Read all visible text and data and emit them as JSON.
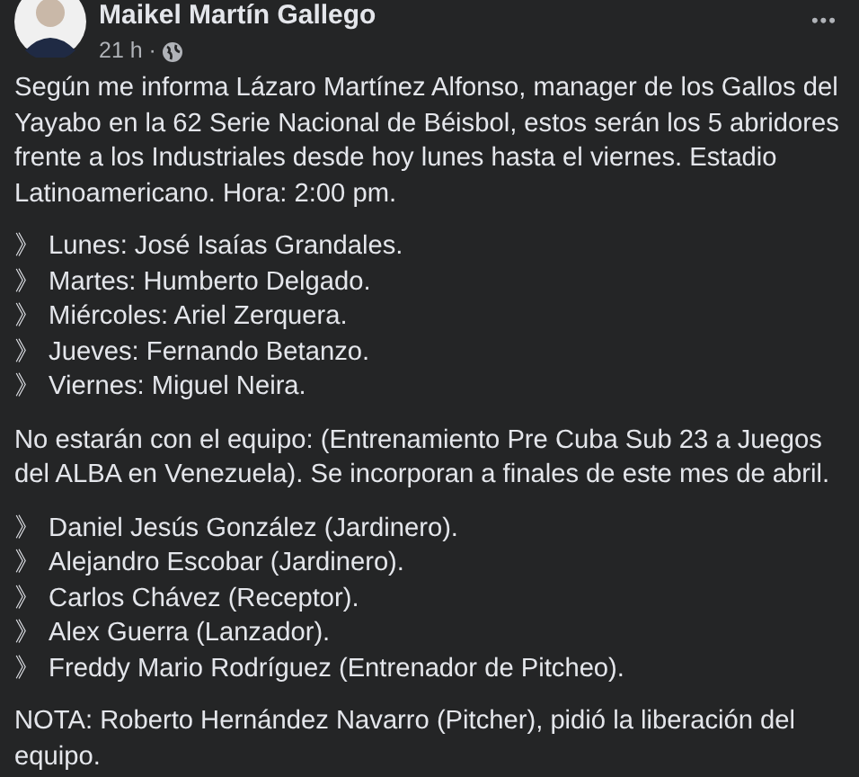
{
  "post": {
    "author": "Maikel Martín Gallego",
    "time": "21 h ·",
    "more": "•••",
    "blocks": [
      {
        "kind": "paragraph",
        "text": "Según me informa Lázaro Martínez Alfonso, manager de los Gallos del Yayabo en la 62 Serie Nacional de Béisbol, estos serán los 5 abridores frente a los Industriales desde hoy lunes hasta el viernes. Estadio Latinoamericano. Hora: 2:00 pm."
      },
      {
        "kind": "list",
        "items": [
          "》 Lunes: José Isaías Grandales.",
          "》 Martes: Humberto Delgado.",
          "》 Miércoles: Ariel Zerquera.",
          "》 Jueves: Fernando Betanzo.",
          "》 Viernes: Miguel Neira."
        ]
      },
      {
        "kind": "paragraph",
        "text": "No estarán con el equipo: (Entrenamiento Pre Cuba Sub 23 a Juegos del ALBA en Venezuela). Se incorporan a finales de este mes de abril."
      },
      {
        "kind": "list",
        "items": [
          "》 Daniel Jesús González (Jardinero).",
          "》 Alejandro Escobar (Jardinero).",
          "》 Carlos Chávez (Receptor).",
          "》 Alex Guerra (Lanzador).",
          "》 Freddy Mario Rodríguez (Entrenador de Pitcheo)."
        ]
      },
      {
        "kind": "paragraph",
        "text": "NOTA: Roberto Hernández Navarro (Pitcher), pidió la liberación del equipo."
      }
    ]
  }
}
